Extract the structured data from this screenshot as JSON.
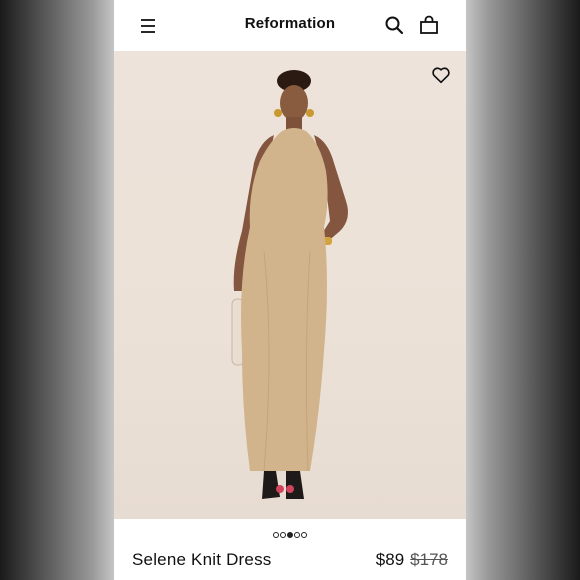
{
  "header": {
    "brand": "Reformation",
    "menu_icon": "hamburger-menu-icon",
    "search_icon": "search-icon",
    "bag_icon": "shopping-bag-icon"
  },
  "product_image": {
    "favorite_icon": "heart-outline-icon",
    "carousel": {
      "total": 5,
      "active_index": 2
    }
  },
  "product": {
    "name": "Selene Knit Dress",
    "sale_price": "$89",
    "original_price": "$178"
  },
  "colors": {
    "photo_background": "#ebe1d7",
    "dress": "#d2b48c",
    "text": "#111111"
  }
}
